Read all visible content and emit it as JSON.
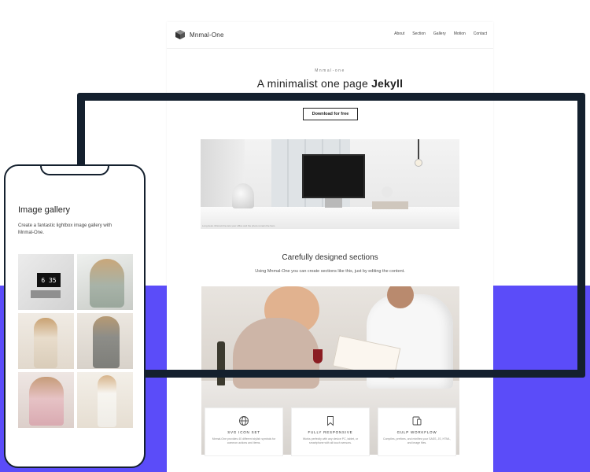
{
  "site": {
    "logo_text": "Mnmal-One",
    "nav": [
      "About",
      "Section",
      "Gallery",
      "Motion",
      "Contact"
    ]
  },
  "hero": {
    "eyebrow": "Mnmal-one",
    "headline_prefix": "A minimalist one page",
    "headline_bold": "Jekyll",
    "cta_label": "Download for free",
    "photo_caption": "Long desk. Mnmal-One lets your office and the photo remain the hero."
  },
  "sections": {
    "title": "Carefully designed sections",
    "subtitle": "Using Mnmal-One you can create sections like this, just by editing the content."
  },
  "features": [
    {
      "icon": "globe-icon",
      "title": "SVG ICON SET",
      "desc": "Mnmal-One provides 40 different stylish symbols for common actions and items."
    },
    {
      "icon": "bookmark-icon",
      "title": "FULLY RESPONSIVE",
      "desc": "Works perfectly with any device PC, tablet, or smartphone with all touch sensors."
    },
    {
      "icon": "devices-icon",
      "title": "GULP WORKFLOW",
      "desc": "Compiles, prefixes, and minifies your SASS, JS, HTML, and image files."
    }
  ],
  "phone": {
    "title": "Image gallery",
    "description": "Create a fantastic lightbox image gallery with Mnmal-One.",
    "clock_text": "6 35"
  },
  "colors": {
    "accent_band": "#5b4cf9",
    "frame": "#14202e"
  }
}
